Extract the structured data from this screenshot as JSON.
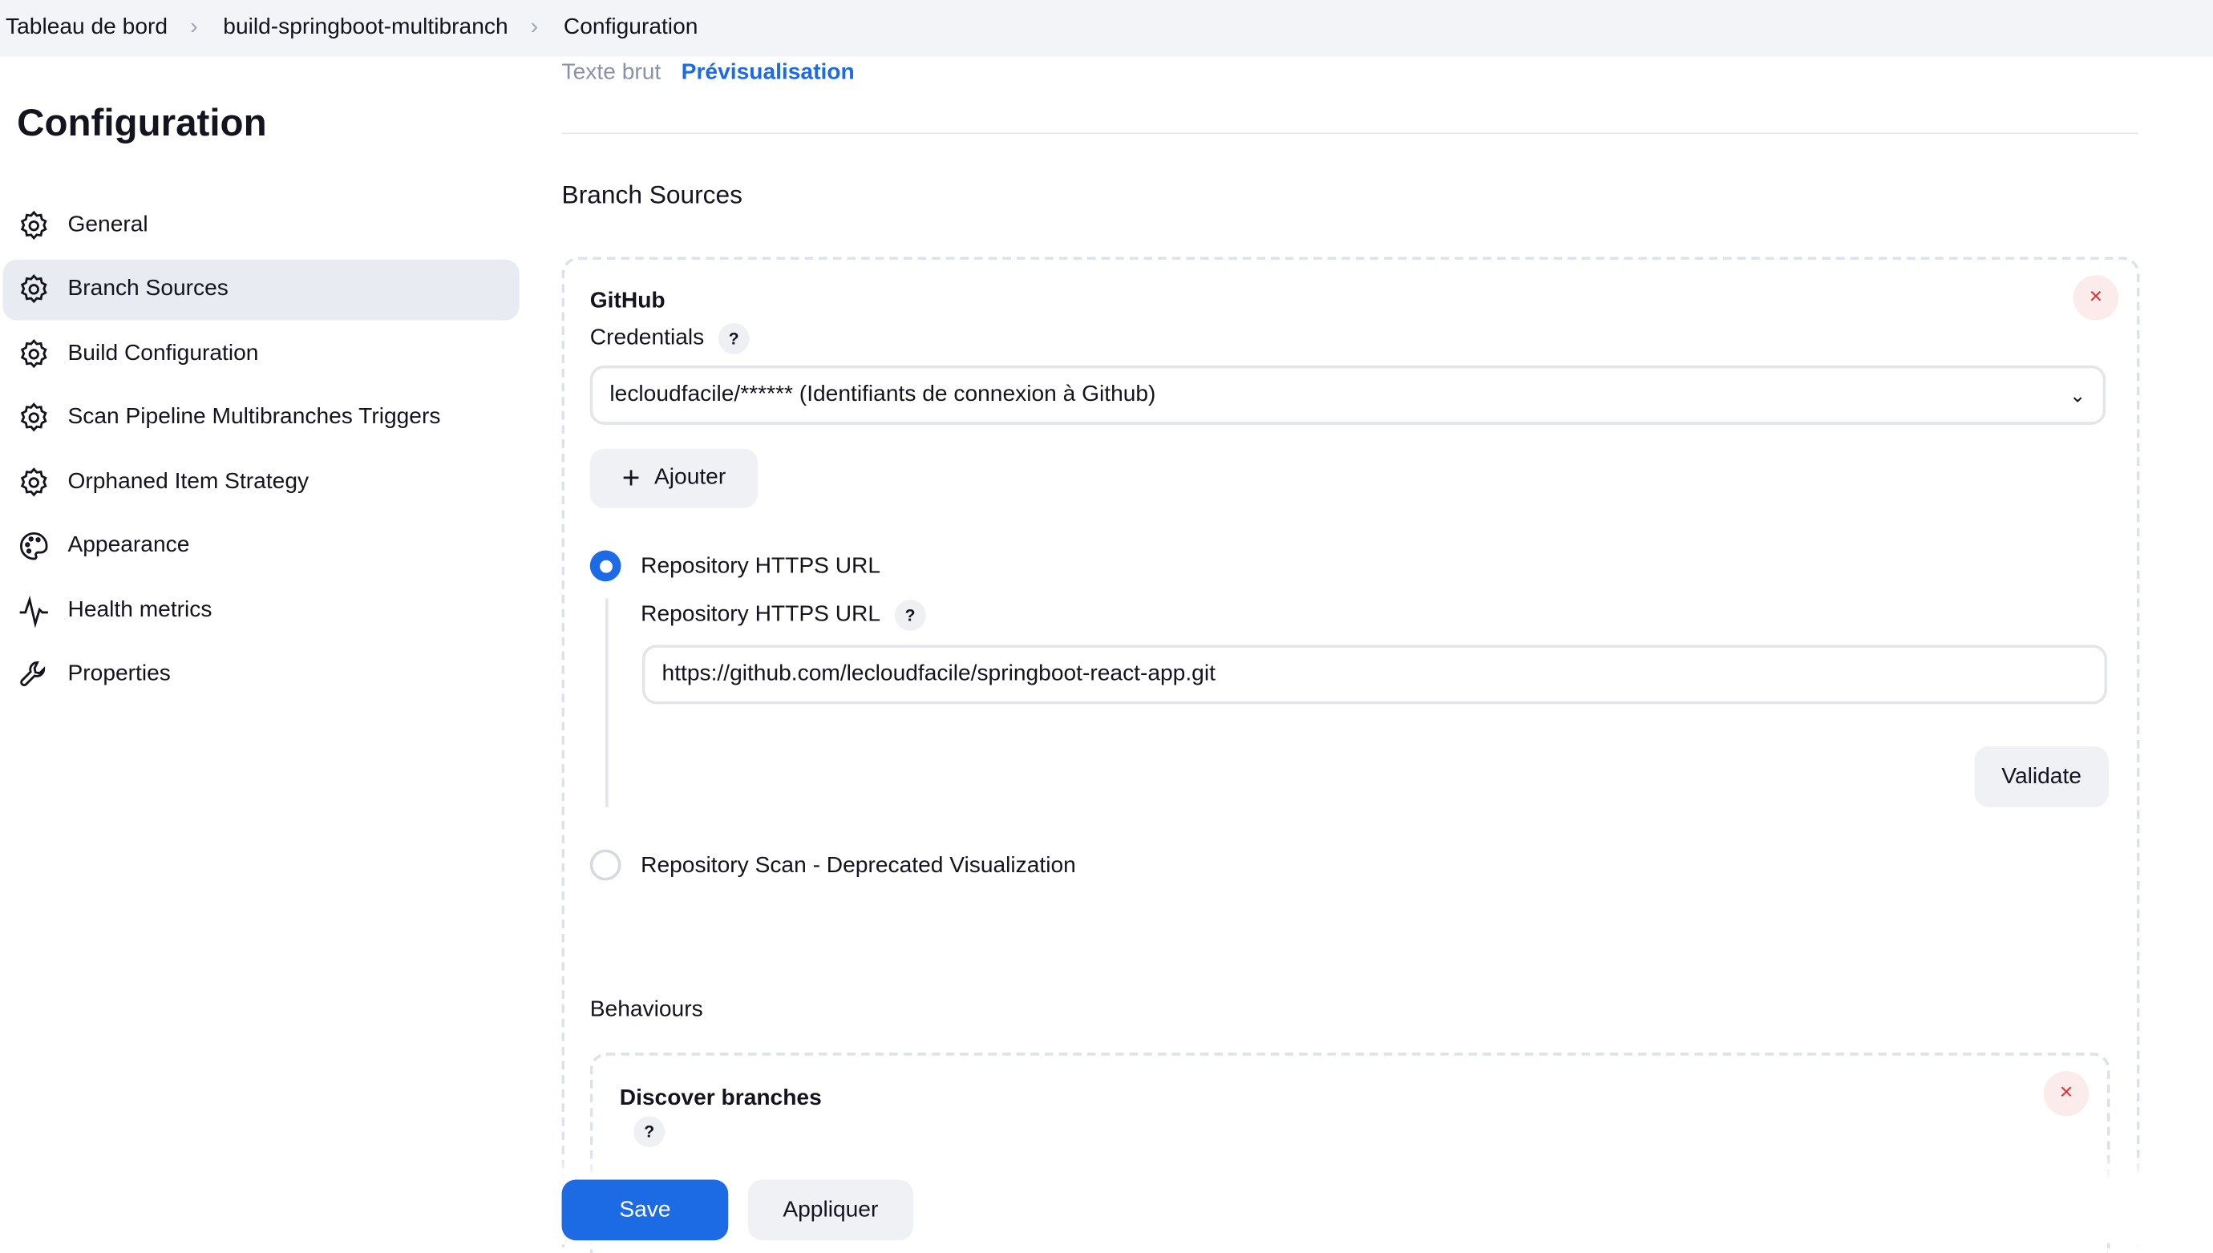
{
  "breadcrumb": [
    "Tableau de bord",
    "build-springboot-multibranch",
    "Configuration"
  ],
  "page_title": "Configuration",
  "sidebar": {
    "items": [
      {
        "label": "General",
        "icon": "gear-icon"
      },
      {
        "label": "Branch Sources",
        "icon": "gear-icon",
        "active": true
      },
      {
        "label": "Build Configuration",
        "icon": "gear-icon"
      },
      {
        "label": "Scan Pipeline Multibranches Triggers",
        "icon": "gear-icon"
      },
      {
        "label": "Orphaned Item Strategy",
        "icon": "gear-icon"
      },
      {
        "label": "Appearance",
        "icon": "palette-icon"
      },
      {
        "label": "Health metrics",
        "icon": "pulse-icon"
      },
      {
        "label": "Properties",
        "icon": "wrench-icon"
      }
    ]
  },
  "tabs": {
    "raw": "Texte brut",
    "preview": "Prévisualisation"
  },
  "section_title": "Branch Sources",
  "github": {
    "title": "GitHub",
    "credentials_label": "Credentials",
    "credentials_value": "lecloudfacile/****** (Identifiants de connexion à Github)",
    "add_label": "Ajouter",
    "radio_https": "Repository HTTPS URL",
    "url_label": "Repository HTTPS URL",
    "url_value": "https://github.com/lecloudfacile/springboot-react-app.git",
    "validate_label": "Validate",
    "radio_scan": "Repository Scan - Deprecated Visualization",
    "behaviours_label": "Behaviours",
    "discover_title": "Discover branches"
  },
  "help_glyph": "?",
  "close_glyph": "×",
  "footer": {
    "save": "Save",
    "apply": "Appliquer"
  },
  "colors": {
    "accent": "#1d6ae5",
    "danger": "#d33333"
  }
}
